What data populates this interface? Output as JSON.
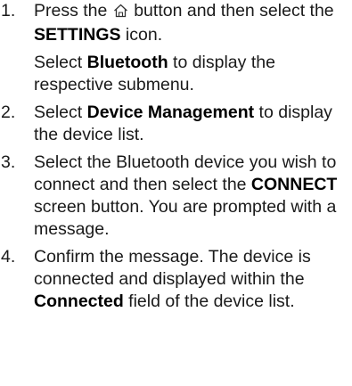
{
  "steps": [
    {
      "number": "1.",
      "paragraphs": [
        {
          "t1": "Press the ",
          "icon": "home-icon",
          "t2": " button and then select the ",
          "b1": "SETTINGS",
          "t3": " icon."
        },
        {
          "t1": "Select ",
          "b1": "Bluetooth",
          "t2": " to display the respective submenu."
        }
      ]
    },
    {
      "number": "2.",
      "paragraphs": [
        {
          "t1": "Select ",
          "b1": "Device Management",
          "t2": " to display the device list."
        }
      ]
    },
    {
      "number": "3.",
      "paragraphs": [
        {
          "t1": "Select the Bluetooth device you wish to connect and then select the ",
          "b1": "CONNECT",
          "t2": " screen button. You are prompted with a message."
        }
      ]
    },
    {
      "number": "4.",
      "paragraphs": [
        {
          "t1": "Confirm the message. The device is connected and displayed within the ",
          "b1": "Connected",
          "t2": " field of the device list."
        }
      ]
    }
  ]
}
